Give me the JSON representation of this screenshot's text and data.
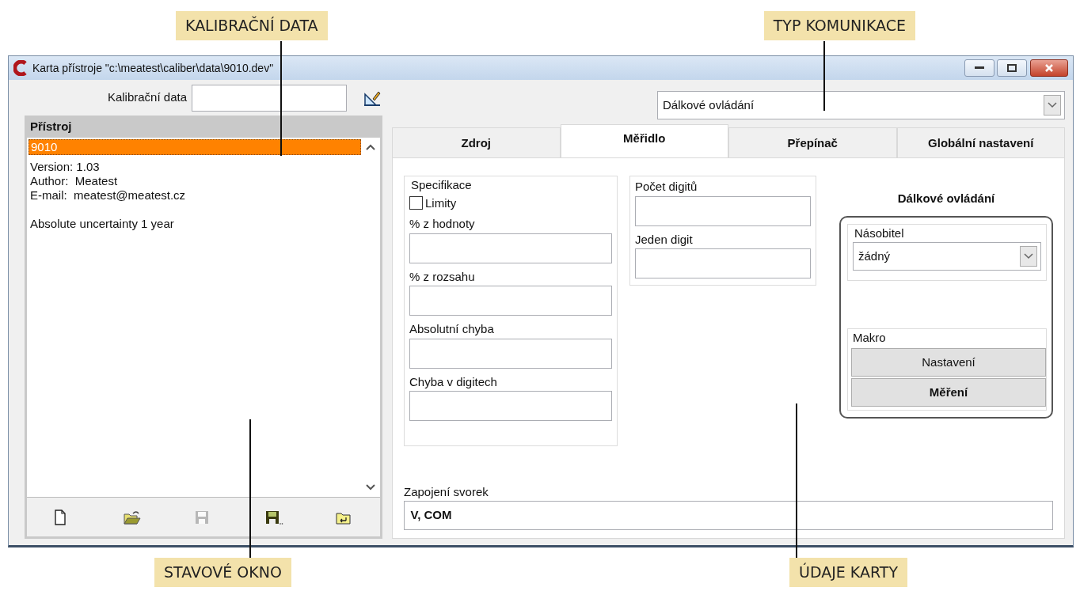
{
  "callouts_top": [
    "KALIBRAČNÍ DATA",
    "TYP KOMUNIKACE"
  ],
  "callouts_bottom": [
    "STAVOVÉ OKNO",
    "ÚDAJE KARTY"
  ],
  "window": {
    "title": "Karta přístroje \"c:\\meatest\\caliber\\data\\9010.dev\""
  },
  "calibration": {
    "label": "Kalibrační data"
  },
  "communication": {
    "value": "Dálkové ovládání"
  },
  "device_panel": {
    "header": "Přístroj",
    "items": [
      {
        "text": "9010",
        "selected": true
      }
    ],
    "info_blocks": [
      {
        "lines": [
          "Version: 1.03",
          "Author:  Meatest",
          "E-mail:  meatest@meatest.cz"
        ]
      },
      {
        "lines": [
          "Absolute uncertainty 1 year"
        ]
      }
    ],
    "toolbar": [
      {
        "kind": "new",
        "disabled": false
      },
      {
        "kind": "open",
        "disabled": false
      },
      {
        "kind": "save",
        "disabled": true
      },
      {
        "kind": "save-as",
        "disabled": false
      },
      {
        "kind": "folder-up",
        "disabled": false
      }
    ]
  },
  "tabs": [
    {
      "label": "Zdroj",
      "selected": false
    },
    {
      "label": "Měřidlo",
      "selected": true
    },
    {
      "label": "Přepínač",
      "selected": false
    },
    {
      "label": "Globální nastavení",
      "selected": false
    }
  ],
  "specification": {
    "legend": "Specifikace",
    "limits": {
      "label": "Limity",
      "checked": false
    },
    "fields": [
      {
        "label": "% z hodnoty"
      },
      {
        "label": "% z rozsahu"
      },
      {
        "label": "Absolutní chyba"
      },
      {
        "label": "Chyba v digitech"
      }
    ]
  },
  "digits": {
    "fields": [
      {
        "label": "Počet digitů"
      },
      {
        "label": "Jeden digit"
      }
    ]
  },
  "remote": {
    "title": "Dálkové ovládání",
    "multiplier": {
      "legend": "Násobitel",
      "value": "žádný"
    },
    "macro": {
      "legend": "Makro",
      "buttons": [
        {
          "label": "Nastavení",
          "bold": false
        },
        {
          "label": "Měření",
          "bold": true
        }
      ]
    }
  },
  "terminals": {
    "label": "Zapojení svorek",
    "value": "V, COM"
  }
}
